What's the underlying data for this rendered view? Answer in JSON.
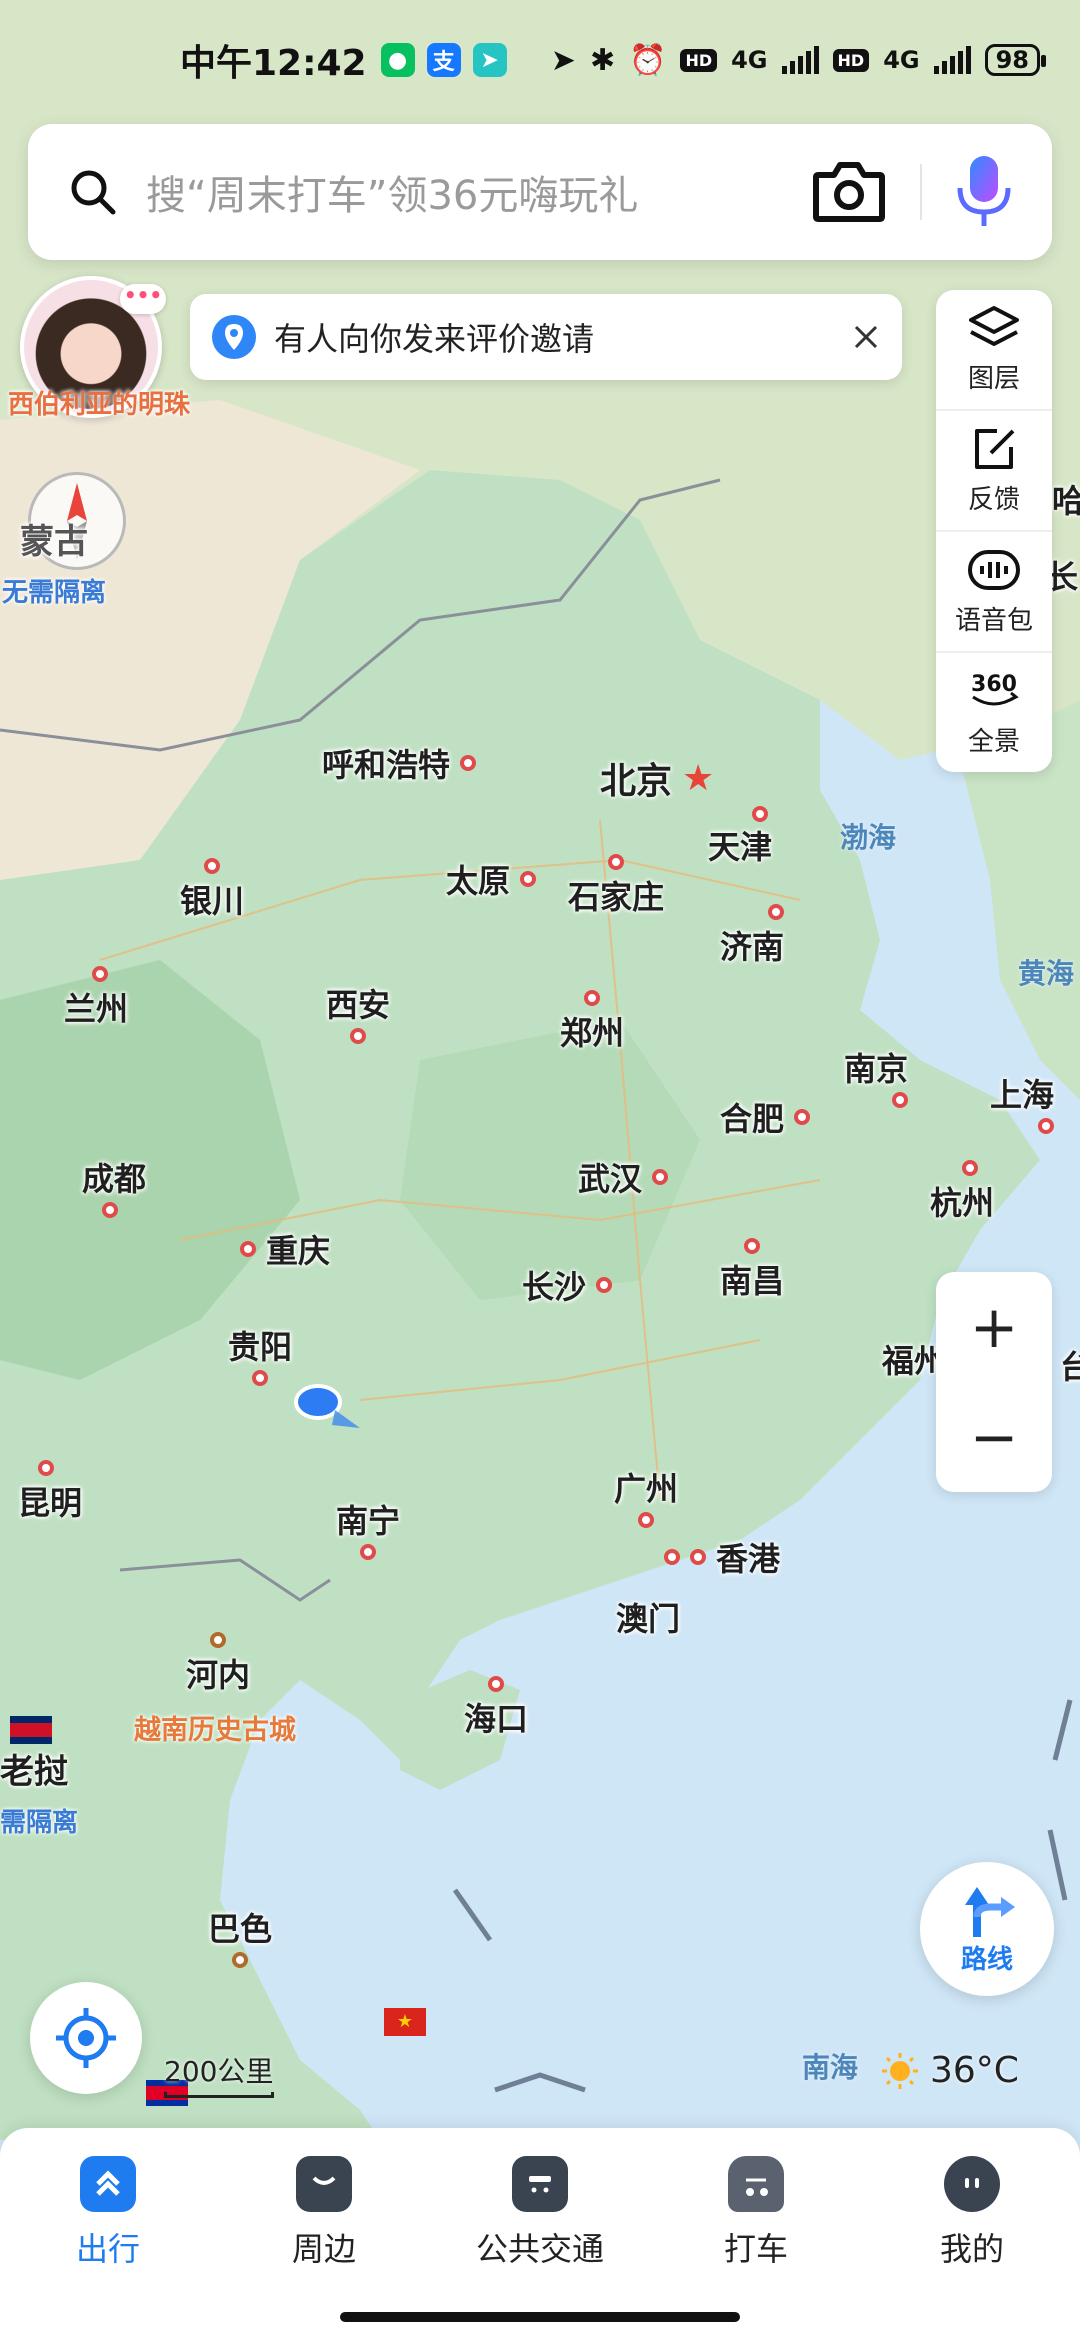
{
  "status_bar": {
    "time": "中午12:42",
    "network_label": "4G",
    "hd_label": "HD",
    "battery": "98"
  },
  "search": {
    "placeholder": "搜“周末打车”领36元嗨玩礼"
  },
  "notice": {
    "text": "有人向你发来评价邀请"
  },
  "avatar": {
    "bubble": "•••",
    "caption": "西伯利亚的明珠"
  },
  "compass": {
    "region_label": "蒙古",
    "caption": "无需隔离"
  },
  "tools": [
    {
      "icon": "layers-icon",
      "label": "图层"
    },
    {
      "icon": "feedback-icon",
      "label": "反馈"
    },
    {
      "icon": "voice-pack-icon",
      "label": "语音包"
    },
    {
      "icon": "panorama-360-icon",
      "label": "全景"
    }
  ],
  "map": {
    "capital": "北京",
    "cities": {
      "hohhot": "呼和浩特",
      "tianjin": "天津",
      "taiyuan": "太原",
      "shijiazhuang": "石家庄",
      "yinchuan": "银川",
      "jinan": "济南",
      "lanzhou": "兰州",
      "xian": "西安",
      "zhengzhou": "郑州",
      "nanjing": "南京",
      "hefei": "合肥",
      "shanghai": "上海",
      "chengdu": "成都",
      "wuhan": "武汉",
      "hangzhou": "杭州",
      "chongqing": "重庆",
      "changsha": "长沙",
      "nanchang": "南昌",
      "guiyang": "贵阳",
      "fuzhou": "福州",
      "kunming": "昆明",
      "nanning": "南宁",
      "guangzhou": "广州",
      "hongkong": "香港",
      "macau": "澳门",
      "hanoi": "河内",
      "haikou": "海口",
      "pakse": "巴色",
      "harbin_partial": "哈",
      "changchun_partial": "长",
      "fuzhou_partial": "福州",
      "taiwan_partial": "台"
    },
    "seas": {
      "bohai": "渤海",
      "yellow_sea": "黄海",
      "south_sea": "南海"
    },
    "pois": {
      "vietnam_old_town": "越南历史古城",
      "laos": "老挝",
      "laos_caption": "需隔离"
    },
    "scale_label": "200公里"
  },
  "weather": {
    "temperature": "36°C"
  },
  "zoom": {
    "in": "+",
    "out": "−"
  },
  "route": {
    "label": "路线"
  },
  "bottom_nav": [
    {
      "icon": "travel-icon",
      "label": "出行",
      "active": true
    },
    {
      "icon": "nearby-icon",
      "label": "周边",
      "active": false
    },
    {
      "icon": "transit-icon",
      "label": "公共交通",
      "active": false
    },
    {
      "icon": "taxi-icon",
      "label": "打车",
      "active": false
    },
    {
      "icon": "profile-icon",
      "label": "我的",
      "active": false
    }
  ],
  "colors": {
    "accent": "#1e7bf0",
    "land": "#bfe0c2",
    "sea": "#cfe6f6",
    "city_dot": "#e04a4a",
    "poi_orange": "#e77a3a"
  }
}
